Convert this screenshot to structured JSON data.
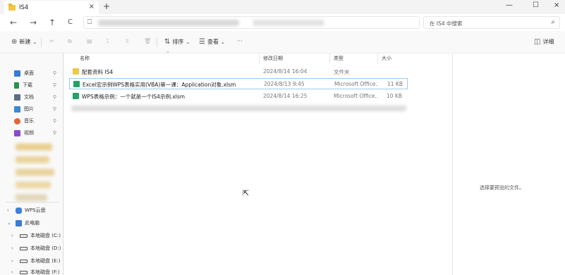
{
  "window": {
    "tab_title": "IS4",
    "tab_close": "×",
    "new_tab": "+",
    "minimize": "—",
    "maximize": "☐",
    "close": "×"
  },
  "nav": {
    "back": "←",
    "forward": "→",
    "up": "↑",
    "refresh": "C",
    "search_placeholder": "在 IS4 中搜索"
  },
  "commandbar": {
    "new_label": "新建",
    "sort_label": "排序",
    "view_label": "查看",
    "details_label": "详细"
  },
  "sidebar": {
    "quick": [
      {
        "label": "桌面",
        "icon": "desktop-icon",
        "color": "#3a7bd5"
      },
      {
        "label": "下载",
        "icon": "download-icon",
        "color": "#2c8e4f"
      },
      {
        "label": "文档",
        "icon": "document-icon",
        "color": "#5a6f86"
      },
      {
        "label": "图片",
        "icon": "picture-icon",
        "color": "#3c89d1"
      },
      {
        "label": "音乐",
        "icon": "music-icon",
        "color": "#e0663b"
      },
      {
        "label": "视频",
        "icon": "video-icon",
        "color": "#8a4cc8"
      }
    ],
    "tree": [
      {
        "label": "WPS云盘",
        "expanded": false
      },
      {
        "label": "此电脑",
        "expanded": true
      },
      {
        "label": "本地磁盘 (C:)",
        "expanded": false
      },
      {
        "label": "本地磁盘 (D:)",
        "expanded": false
      },
      {
        "label": "本地磁盘 (E:)",
        "expanded": false
      },
      {
        "label": "本地磁盘 (F:)",
        "expanded": false
      }
    ]
  },
  "files": {
    "headers": {
      "name": "名称",
      "date": "修改日期",
      "type": "类型",
      "size": "大小"
    },
    "rows": [
      {
        "name": "配套资料 IS4",
        "date": "2024/8/14 16:04",
        "type": "文件夹",
        "size": "",
        "kind": "folder"
      },
      {
        "name": "Excel宏示例WPS表格实用(VBA)第一课：Application对象.xlsm",
        "date": "2024/8/13 9:45",
        "type": "Microsoft Office...",
        "size": "11 KB",
        "kind": "excel"
      },
      {
        "name": "WPS表格示例：一个就是一个IS4示例.xlsm",
        "date": "2024/8/14 16:25",
        "type": "Microsoft Office...",
        "size": "10 KB",
        "kind": "excel"
      }
    ]
  },
  "preview": {
    "message": "选择要预览的文件。"
  }
}
